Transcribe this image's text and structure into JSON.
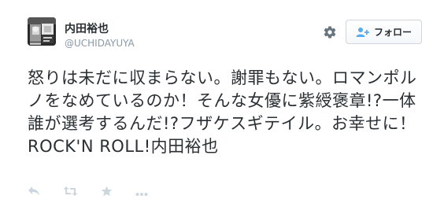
{
  "user": {
    "full_name": "内田裕也",
    "screen_name": "@UCHIDAYUYA"
  },
  "follow_button": {
    "label": "フォロー"
  },
  "tweet": {
    "text": "怒りは未だに収まらない。謝罪もない。ロマンポルノをなめているのか！そんな女優に紫綬褒章!?一体誰が選考するんだ!?フザケスギテイル。お幸せに！ROCK'N ROLL!内田裕也"
  },
  "icons": {
    "settings": "gear-icon",
    "follow": "add-user-icon",
    "reply": "reply-icon",
    "retweet": "retweet-icon",
    "favorite": "star-icon",
    "more": "more-icon"
  },
  "colors": {
    "text": "#292f33",
    "muted": "#8899a6",
    "icon": "#ccd6dd",
    "follow_icon": "#55acee",
    "button_border": "#d0d6db"
  }
}
